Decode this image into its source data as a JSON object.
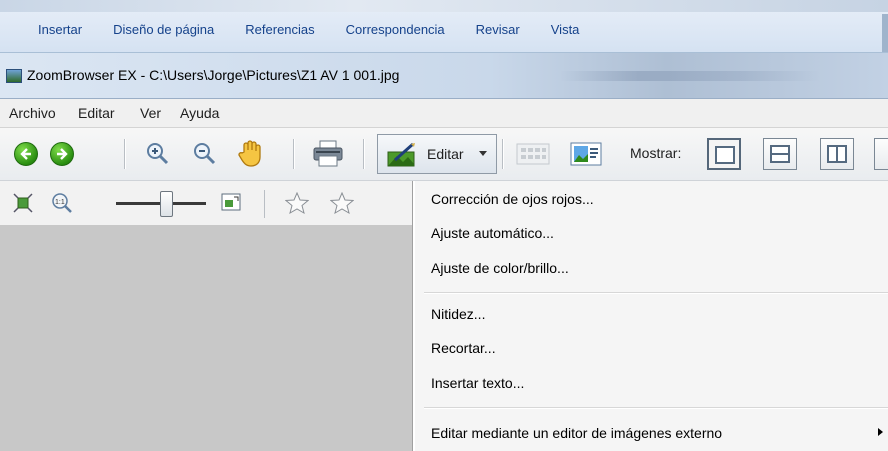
{
  "ribbon": {
    "tabs": [
      "Insertar",
      "Diseño de página",
      "Referencias",
      "Correspondencia",
      "Revisar",
      "Vista"
    ]
  },
  "window": {
    "title": "ZoomBrowser EX - C:\\Users\\Jorge\\Pictures\\Z1 AV 1 001.jpg"
  },
  "menubar": {
    "items": [
      "Archivo",
      "Editar",
      "Ver",
      "Ayuda"
    ]
  },
  "toolbar": {
    "editar_label": "Editar",
    "mostrar_label": "Mostrar:"
  },
  "edit_menu": {
    "items": [
      "Corrección de ojos rojos...",
      "Ajuste automático...",
      "Ajuste de color/brillo...",
      "Nitidez...",
      "Recortar...",
      "Insertar texto...",
      "Editar mediante un editor de imágenes externo"
    ]
  },
  "icons": {
    "back": "back-arrow-icon",
    "forward": "forward-arrow-icon",
    "zoom_in": "zoom-in-icon",
    "zoom_out": "zoom-out-icon",
    "hand": "hand-pan-icon",
    "print": "printer-icon",
    "edit": "edit-image-icon",
    "colors": {
      "ribbon_text": "#15428b",
      "go_green": "#2b8f12"
    }
  }
}
